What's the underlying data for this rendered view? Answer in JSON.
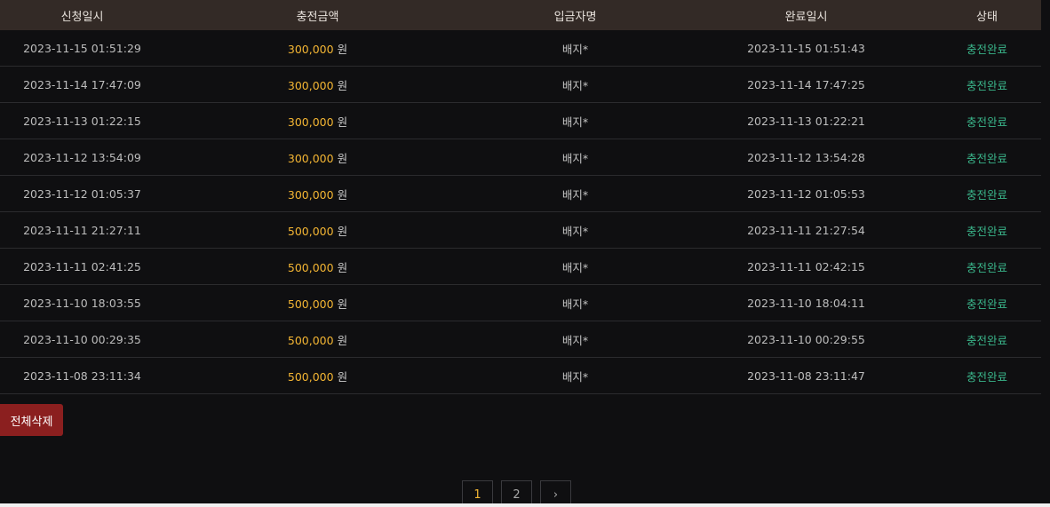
{
  "table": {
    "headers": [
      "신청일시",
      "충전금액",
      "입금자명",
      "완료일시",
      "상태"
    ],
    "currency_unit": "원",
    "rows": [
      {
        "requested": "2023-11-15 01:51:29",
        "amount": "300,000",
        "depositor": "배지*",
        "completed": "2023-11-15 01:51:43",
        "status": "충전완료"
      },
      {
        "requested": "2023-11-14 17:47:09",
        "amount": "300,000",
        "depositor": "배지*",
        "completed": "2023-11-14 17:47:25",
        "status": "충전완료"
      },
      {
        "requested": "2023-11-13 01:22:15",
        "amount": "300,000",
        "depositor": "배지*",
        "completed": "2023-11-13 01:22:21",
        "status": "충전완료"
      },
      {
        "requested": "2023-11-12 13:54:09",
        "amount": "300,000",
        "depositor": "배지*",
        "completed": "2023-11-12 13:54:28",
        "status": "충전완료"
      },
      {
        "requested": "2023-11-12 01:05:37",
        "amount": "300,000",
        "depositor": "배지*",
        "completed": "2023-11-12 01:05:53",
        "status": "충전완료"
      },
      {
        "requested": "2023-11-11 21:27:11",
        "amount": "500,000",
        "depositor": "배지*",
        "completed": "2023-11-11 21:27:54",
        "status": "충전완료"
      },
      {
        "requested": "2023-11-11 02:41:25",
        "amount": "500,000",
        "depositor": "배지*",
        "completed": "2023-11-11 02:42:15",
        "status": "충전완료"
      },
      {
        "requested": "2023-11-10 18:03:55",
        "amount": "500,000",
        "depositor": "배지*",
        "completed": "2023-11-10 18:04:11",
        "status": "충전완료"
      },
      {
        "requested": "2023-11-10 00:29:35",
        "amount": "500,000",
        "depositor": "배지*",
        "completed": "2023-11-10 00:29:55",
        "status": "충전완료"
      },
      {
        "requested": "2023-11-08 23:11:34",
        "amount": "500,000",
        "depositor": "배지*",
        "completed": "2023-11-08 23:11:47",
        "status": "충전완료"
      }
    ]
  },
  "actions": {
    "delete_all_label": "전체삭제"
  },
  "pagination": {
    "pages": [
      "1",
      "2"
    ],
    "current": "1",
    "next_icon": "chevron-right-icon",
    "next_glyph": "›"
  },
  "colors": {
    "header_bg": "#332a26",
    "amount": "#f3b533",
    "status": "#3ab58a",
    "delete_button": "#8b1f1f"
  }
}
